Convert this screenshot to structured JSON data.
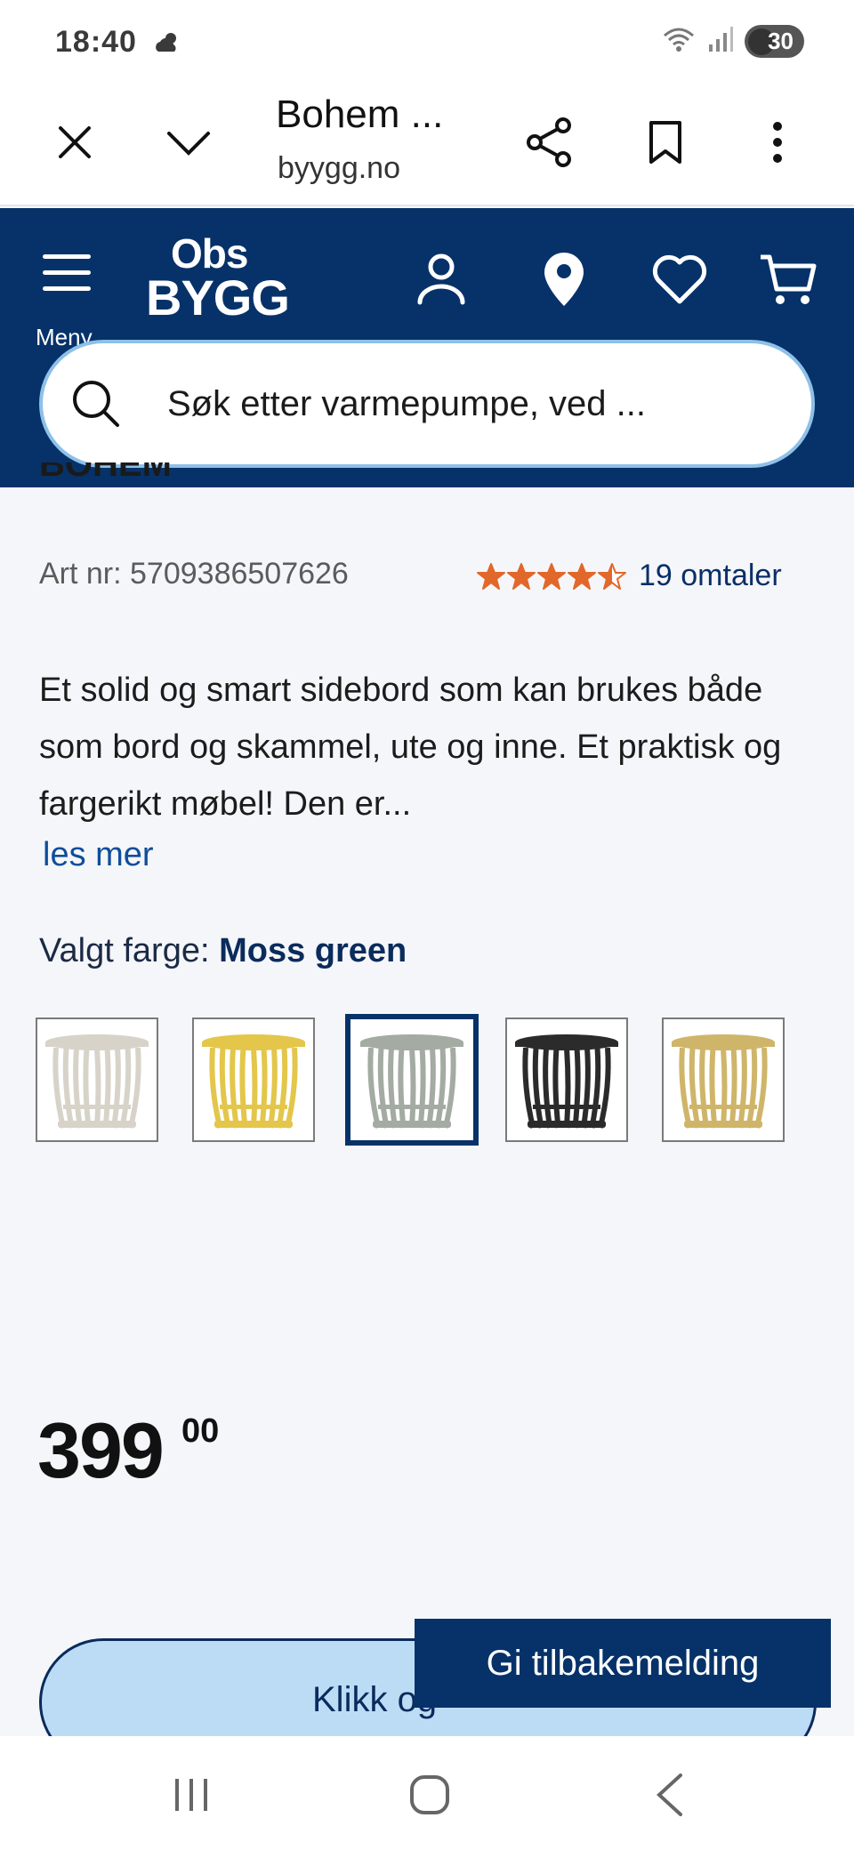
{
  "status_bar": {
    "time": "18:40",
    "battery": "30"
  },
  "browser": {
    "title": "Bohem ...",
    "domain": "byygg.no"
  },
  "header": {
    "menu_label": "Meny",
    "logo_top": "Obs",
    "logo_bottom": "BYGG",
    "search_placeholder": "Søk etter varmepumpe, ved ..."
  },
  "product": {
    "title_partial": "BOHEM",
    "art_nr": "Art nr: 5709386507626",
    "rating_value": 4.5,
    "rating_max": 5,
    "reviews": "19 omtaler",
    "description": "Et solid og smart sidebord som kan brukes både som bord og skammel, ute og inne. Et praktisk og fargerikt møbel! Den er...",
    "read_more": "les mer",
    "color_label": "Valgt farge:",
    "color_selected": "Moss green",
    "swatches": [
      {
        "name": "beige",
        "color": "#d8d3c9"
      },
      {
        "name": "yellow",
        "color": "#e3c64a"
      },
      {
        "name": "moss-green",
        "color": "#a3aba2"
      },
      {
        "name": "black",
        "color": "#2b2b2b"
      },
      {
        "name": "sand",
        "color": "#cfb56a"
      }
    ],
    "selected_swatch_index": 2,
    "price_main": "399",
    "price_cents": "00",
    "cta_label": "Klikk og"
  },
  "feedback_label": "Gi tilbakemelding",
  "colors": {
    "brand_navy": "#063269",
    "cta_light": "#bcdcf5",
    "star_orange": "#e2672a",
    "link_blue": "#0f4e9a"
  }
}
